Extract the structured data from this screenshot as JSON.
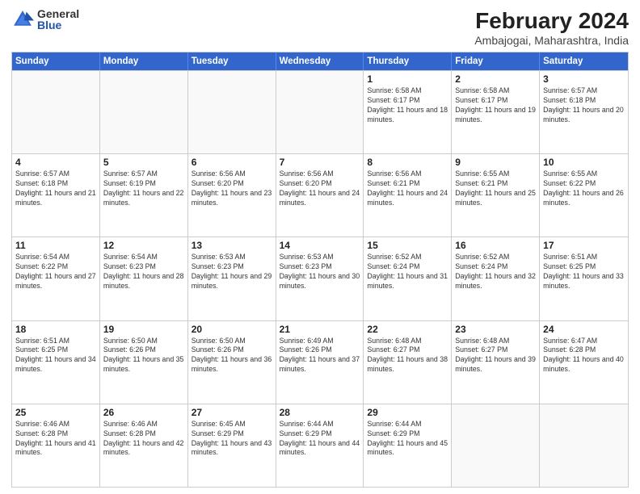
{
  "header": {
    "logo": {
      "general": "General",
      "blue": "Blue"
    },
    "title": "February 2024",
    "subtitle": "Ambajogai, Maharashtra, India"
  },
  "weekdays": [
    "Sunday",
    "Monday",
    "Tuesday",
    "Wednesday",
    "Thursday",
    "Friday",
    "Saturday"
  ],
  "weeks": [
    [
      {
        "day": "",
        "info": ""
      },
      {
        "day": "",
        "info": ""
      },
      {
        "day": "",
        "info": ""
      },
      {
        "day": "",
        "info": ""
      },
      {
        "day": "1",
        "info": "Sunrise: 6:58 AM\nSunset: 6:17 PM\nDaylight: 11 hours and 18 minutes."
      },
      {
        "day": "2",
        "info": "Sunrise: 6:58 AM\nSunset: 6:17 PM\nDaylight: 11 hours and 19 minutes."
      },
      {
        "day": "3",
        "info": "Sunrise: 6:57 AM\nSunset: 6:18 PM\nDaylight: 11 hours and 20 minutes."
      }
    ],
    [
      {
        "day": "4",
        "info": "Sunrise: 6:57 AM\nSunset: 6:18 PM\nDaylight: 11 hours and 21 minutes."
      },
      {
        "day": "5",
        "info": "Sunrise: 6:57 AM\nSunset: 6:19 PM\nDaylight: 11 hours and 22 minutes."
      },
      {
        "day": "6",
        "info": "Sunrise: 6:56 AM\nSunset: 6:20 PM\nDaylight: 11 hours and 23 minutes."
      },
      {
        "day": "7",
        "info": "Sunrise: 6:56 AM\nSunset: 6:20 PM\nDaylight: 11 hours and 24 minutes."
      },
      {
        "day": "8",
        "info": "Sunrise: 6:56 AM\nSunset: 6:21 PM\nDaylight: 11 hours and 24 minutes."
      },
      {
        "day": "9",
        "info": "Sunrise: 6:55 AM\nSunset: 6:21 PM\nDaylight: 11 hours and 25 minutes."
      },
      {
        "day": "10",
        "info": "Sunrise: 6:55 AM\nSunset: 6:22 PM\nDaylight: 11 hours and 26 minutes."
      }
    ],
    [
      {
        "day": "11",
        "info": "Sunrise: 6:54 AM\nSunset: 6:22 PM\nDaylight: 11 hours and 27 minutes."
      },
      {
        "day": "12",
        "info": "Sunrise: 6:54 AM\nSunset: 6:23 PM\nDaylight: 11 hours and 28 minutes."
      },
      {
        "day": "13",
        "info": "Sunrise: 6:53 AM\nSunset: 6:23 PM\nDaylight: 11 hours and 29 minutes."
      },
      {
        "day": "14",
        "info": "Sunrise: 6:53 AM\nSunset: 6:23 PM\nDaylight: 11 hours and 30 minutes."
      },
      {
        "day": "15",
        "info": "Sunrise: 6:52 AM\nSunset: 6:24 PM\nDaylight: 11 hours and 31 minutes."
      },
      {
        "day": "16",
        "info": "Sunrise: 6:52 AM\nSunset: 6:24 PM\nDaylight: 11 hours and 32 minutes."
      },
      {
        "day": "17",
        "info": "Sunrise: 6:51 AM\nSunset: 6:25 PM\nDaylight: 11 hours and 33 minutes."
      }
    ],
    [
      {
        "day": "18",
        "info": "Sunrise: 6:51 AM\nSunset: 6:25 PM\nDaylight: 11 hours and 34 minutes."
      },
      {
        "day": "19",
        "info": "Sunrise: 6:50 AM\nSunset: 6:26 PM\nDaylight: 11 hours and 35 minutes."
      },
      {
        "day": "20",
        "info": "Sunrise: 6:50 AM\nSunset: 6:26 PM\nDaylight: 11 hours and 36 minutes."
      },
      {
        "day": "21",
        "info": "Sunrise: 6:49 AM\nSunset: 6:26 PM\nDaylight: 11 hours and 37 minutes."
      },
      {
        "day": "22",
        "info": "Sunrise: 6:48 AM\nSunset: 6:27 PM\nDaylight: 11 hours and 38 minutes."
      },
      {
        "day": "23",
        "info": "Sunrise: 6:48 AM\nSunset: 6:27 PM\nDaylight: 11 hours and 39 minutes."
      },
      {
        "day": "24",
        "info": "Sunrise: 6:47 AM\nSunset: 6:28 PM\nDaylight: 11 hours and 40 minutes."
      }
    ],
    [
      {
        "day": "25",
        "info": "Sunrise: 6:46 AM\nSunset: 6:28 PM\nDaylight: 11 hours and 41 minutes."
      },
      {
        "day": "26",
        "info": "Sunrise: 6:46 AM\nSunset: 6:28 PM\nDaylight: 11 hours and 42 minutes."
      },
      {
        "day": "27",
        "info": "Sunrise: 6:45 AM\nSunset: 6:29 PM\nDaylight: 11 hours and 43 minutes."
      },
      {
        "day": "28",
        "info": "Sunrise: 6:44 AM\nSunset: 6:29 PM\nDaylight: 11 hours and 44 minutes."
      },
      {
        "day": "29",
        "info": "Sunrise: 6:44 AM\nSunset: 6:29 PM\nDaylight: 11 hours and 45 minutes."
      },
      {
        "day": "",
        "info": ""
      },
      {
        "day": "",
        "info": ""
      }
    ]
  ]
}
